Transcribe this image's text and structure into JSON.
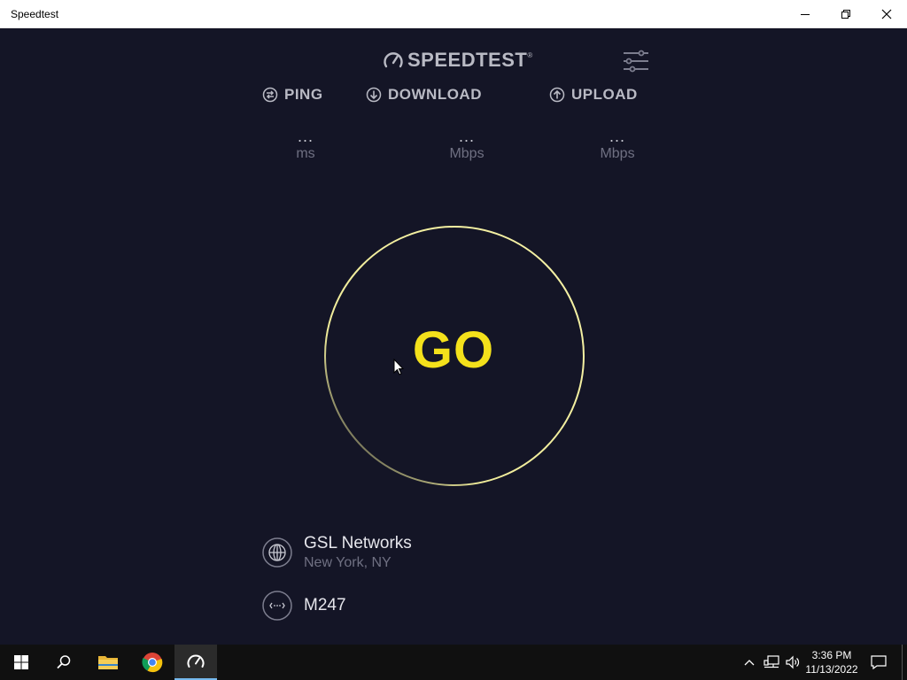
{
  "window": {
    "title": "Speedtest"
  },
  "header": {
    "logo_text": "SPEEDTEST",
    "logo_mark": "®"
  },
  "metrics": [
    {
      "label": "PING",
      "value": "...",
      "unit": "ms",
      "icon": "ping-icon"
    },
    {
      "label": "DOWNLOAD",
      "value": "...",
      "unit": "Mbps",
      "icon": "download-arrow-icon"
    },
    {
      "label": "UPLOAD",
      "value": "...",
      "unit": "Mbps",
      "icon": "upload-arrow-icon"
    }
  ],
  "go": {
    "label": "GO"
  },
  "server": {
    "name": "GSL Networks",
    "location": "New York, NY",
    "icon": "globe-icon"
  },
  "provider": {
    "name": "M247",
    "icon": "connection-icon"
  },
  "taskbar": {
    "time": "3:36 PM",
    "date": "11/13/2022"
  },
  "colors": {
    "background": "#141526",
    "accent": "#f4e11b",
    "muted": "#6f7082",
    "label": "#b9bac4"
  }
}
